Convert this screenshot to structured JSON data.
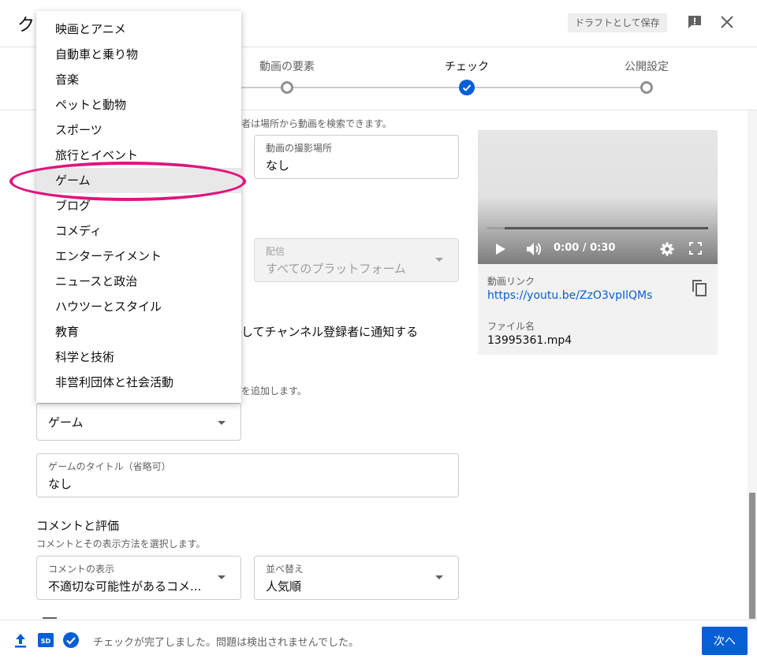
{
  "header": {
    "title": "ク",
    "draft_button": "ドラフトとして保存"
  },
  "stepper": {
    "steps": [
      {
        "label": "動画の要素",
        "state": "pending"
      },
      {
        "label": "チェック",
        "state": "done"
      },
      {
        "label": "公開設定",
        "state": "pending"
      }
    ]
  },
  "location": {
    "caption": "者は場所から動画を検索できます。",
    "label": "動画の撮影場所",
    "value": "なし"
  },
  "distribution": {
    "label": "配信",
    "value": "すべてのプラットフォーム"
  },
  "notify_text": "してチャンネル登録者に通知する",
  "category": {
    "caption": "を追加します。",
    "value": "ゲーム",
    "menu_items": [
      "映画とアニメ",
      "自動車と乗り物",
      "音楽",
      "ペットと動物",
      "スポーツ",
      "旅行とイベント",
      "ゲーム",
      "ブログ",
      "コメディ",
      "エンターテイメント",
      "ニュースと政治",
      "ハウツーとスタイル",
      "教育",
      "科学と技術",
      "非営利団体と社会活動"
    ],
    "selected_index": 6
  },
  "game_title": {
    "label": "ゲームのタイトル（省略可）",
    "value": "なし"
  },
  "comments": {
    "title": "コメントと評価",
    "caption": "コメントとその表示方法を選択します。",
    "display_label": "コメントの表示",
    "display_value": "不適切な可能性があるコメ...",
    "sort_label": "並べ替え",
    "sort_value": "人気順"
  },
  "video": {
    "time": "0:00 / 0:30",
    "link_label": "動画リンク",
    "link": "https://youtu.be/ZzO3vpIlQMs",
    "file_label": "ファイル名",
    "file_name": "13995361.mp4"
  },
  "footer": {
    "status": "チェックが完了しました。問題は検出されませんでした。",
    "next_button": "次へ"
  },
  "colors": {
    "accent": "#065fd4",
    "highlight": "#e0157f"
  }
}
